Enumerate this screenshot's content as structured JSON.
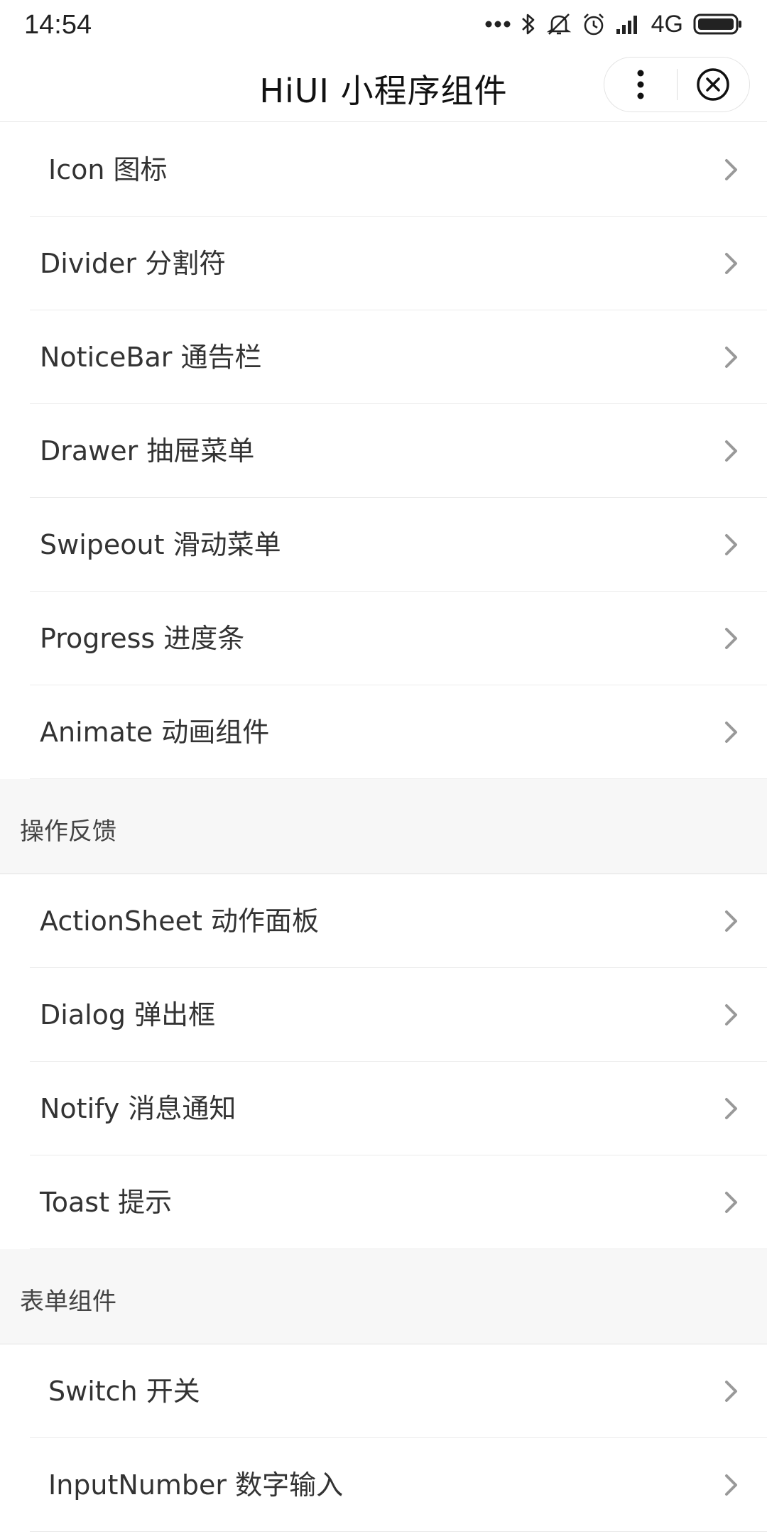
{
  "status_bar": {
    "time": "14:54",
    "network": "4G",
    "icons": [
      "more-dots-icon",
      "bluetooth-icon",
      "mute-icon",
      "alarm-icon",
      "signal-icon",
      "battery-icon"
    ]
  },
  "nav": {
    "title": "HiUI  小程序组件",
    "more_icon": "more-vertical-icon",
    "close_icon": "close-circle-icon"
  },
  "colors": {
    "section_background": "#f7f7f7",
    "divider": "#ececec",
    "text": "#333333",
    "chevron": "#999999"
  },
  "groups": [
    {
      "header": "",
      "items": [
        {
          "label": " Icon 图标"
        },
        {
          "label": "Divider 分割符"
        },
        {
          "label": "NoticeBar 通告栏"
        },
        {
          "label": "Drawer 抽屉菜单"
        },
        {
          "label": "Swipeout 滑动菜单"
        },
        {
          "label": "Progress 进度条"
        },
        {
          "label": "Animate 动画组件"
        }
      ]
    },
    {
      "header": "操作反馈",
      "items": [
        {
          "label": "ActionSheet 动作面板"
        },
        {
          "label": "Dialog 弹出框"
        },
        {
          "label": "Notify 消息通知"
        },
        {
          "label": "Toast 提示"
        }
      ]
    },
    {
      "header": "表单组件",
      "items": [
        {
          "label": " Switch 开关"
        },
        {
          "label": " InputNumber  数字输入"
        }
      ]
    }
  ]
}
